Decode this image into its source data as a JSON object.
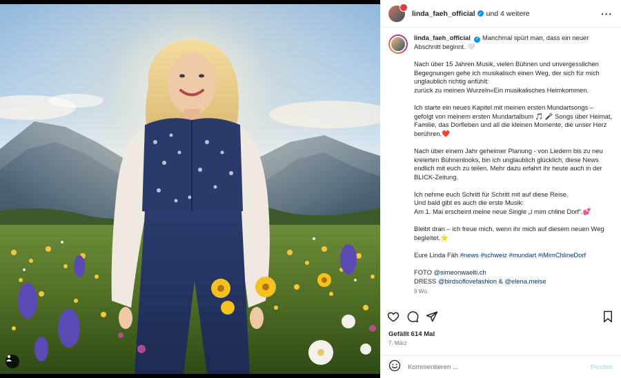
{
  "post": {
    "image_alt": "",
    "tags_icon": "user-tag-icon"
  },
  "header": {
    "username": "linda_faeh_official",
    "collab_text": "und 4 weitere",
    "more_icon": "more-horizontal-icon"
  },
  "caption": {
    "username": "linda_faeh_official",
    "lines": [
      "Manchmal spürt man, dass ein neuer Abschnitt beginnt. 🤍",
      "",
      "Nach über 15 Jahren Musik, vielen Bühnen und unvergesslichen Begegnungen gehe ich musikalisch einen Weg, der sich für mich unglaublich richtig anfühlt:",
      "zurück zu meinen Wurzeln«Ein musikalisches Heimkommen.",
      "",
      "Ich starte ein neues Kapitel mit meinen ersten Mundartsongs – gefolgt von meinem ersten Mundartalbum 🎵 🎤 Songs über Heimat, Familie, das Dorfleben und all die kleinen Momente, die unser Herz berühren.❤️",
      "",
      "Nach über einem Jahr geheimer Planung - von Liedern bis zu neu kreierten Bühnenlooks, bin ich unglaublich glücklich, diese News endlich mit euch zu teilen. Mehr dazu erfahrt ihr heute auch in der BLICK-Zeitung.",
      "",
      "Ich nehme euch Schritt für Schritt mit auf diese Reise.",
      "Und bald gibt es auch die erste Musik:",
      "Am 1. Mai erscheint meine neue Single „I mim chline Dorf“.💕",
      "",
      "Bleibt dran – ich freue mich, wenn ihr mich auf diesem neuen Weg begleitet.⭐"
    ],
    "signoff": "Eure Linda Fäh",
    "hashtags": [
      "#news",
      "#schweiz",
      "#mundart",
      "#iMimChlineDorf"
    ],
    "foto_label": "FOTO",
    "foto_handle": "@simeonwaelti.ch",
    "dress_label": "DRESS",
    "dress_handle_1": "@birdsoflovefashion",
    "dress_and": "&",
    "dress_handle_2": "@elena.meise",
    "age": "9 Wo."
  },
  "actions": {
    "like_icon": "heart-icon",
    "comment_icon": "comment-icon",
    "share_icon": "share-icon",
    "save_icon": "bookmark-icon"
  },
  "likes": "Gefällt 614 Mal",
  "date": "7. März",
  "comment_box": {
    "emoji_icon": "emoji-icon",
    "placeholder": "Kommentieren ...",
    "post_label": "Posten"
  },
  "colors": {
    "link": "#00376b",
    "verified": "#0095f6",
    "post_button_disabled": "#b2dffc"
  }
}
